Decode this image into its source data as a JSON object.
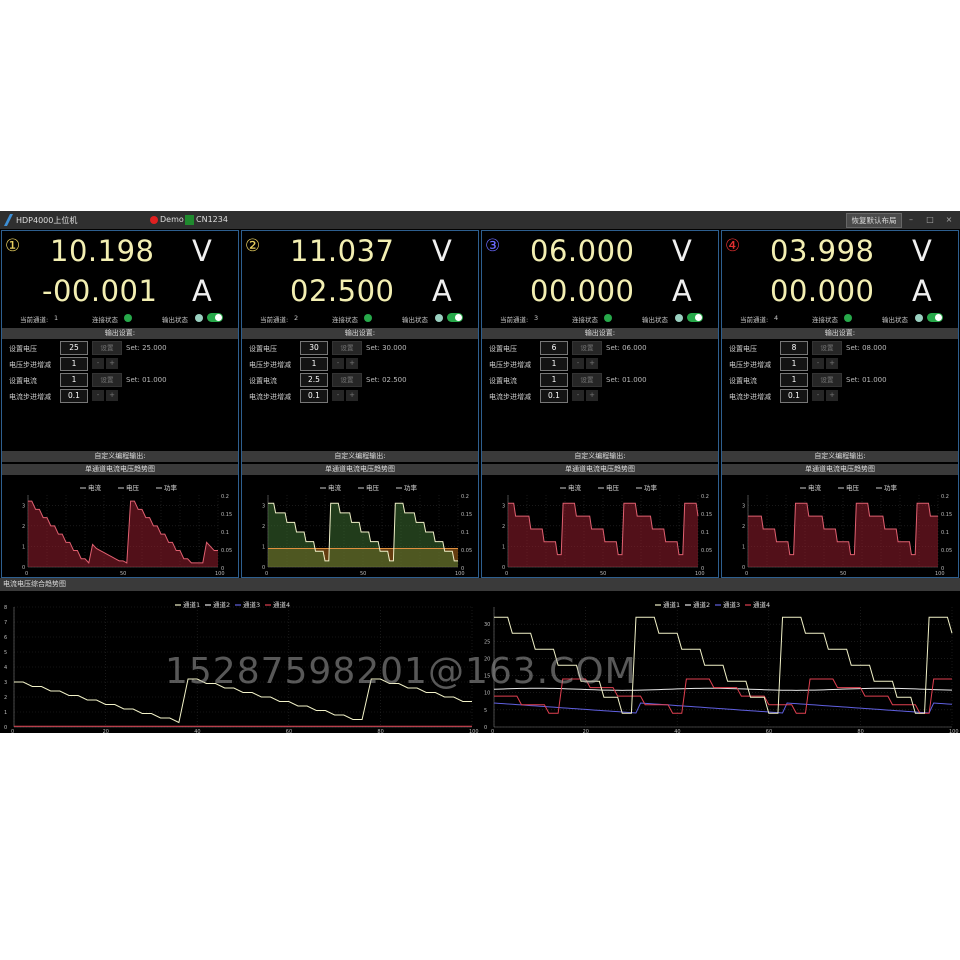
{
  "titlebar": {
    "title": "HDP4000上位机",
    "demo_label": "Demo",
    "cn_label": "CN1234",
    "restore_label": "恢复默认布局",
    "min_symbol": "–",
    "max_symbol": "□",
    "close_symbol": "×"
  },
  "labels": {
    "current_channel": "当前通道:",
    "connection_status": "连接状态",
    "output_status": "输出状态",
    "output_settings": "输出设置:",
    "set_voltage": "设置电压",
    "voltage_step": "电压步进增减",
    "set_current": "设置电流",
    "current_step": "电流步进增减",
    "set_button": "设置",
    "minus": "-",
    "plus": "+",
    "custom_program": "自定义编程输出:",
    "single_trend": "单通道电流电压趋势图",
    "unit_v": "V",
    "unit_a": "A",
    "legend_current": "电流",
    "legend_voltage": "电压",
    "legend_power": "功率"
  },
  "channels": [
    {
      "badge": "①",
      "badge_color": "#e8d060",
      "voltage": "10.198",
      "current": "-00.001",
      "num": "1",
      "set_voltage": "25",
      "voltage_step": "1",
      "set_current": "1",
      "current_step": "0.1",
      "set_voltage_display": "Set: 25.000",
      "set_current_display": "Set: 01.000"
    },
    {
      "badge": "②",
      "badge_color": "#e8d060",
      "voltage": "11.037",
      "current": "02.500",
      "num": "2",
      "set_voltage": "30",
      "voltage_step": "1",
      "set_current": "2.5",
      "current_step": "0.1",
      "set_voltage_display": "Set: 30.000",
      "set_current_display": "Set: 02.500"
    },
    {
      "badge": "③",
      "badge_color": "#6b6bff",
      "voltage": "06.000",
      "current": "00.000",
      "num": "3",
      "set_voltage": "6",
      "voltage_step": "1",
      "set_current": "1",
      "current_step": "0.1",
      "set_voltage_display": "Set: 06.000",
      "set_current_display": "Set: 01.000"
    },
    {
      "badge": "④",
      "badge_color": "#e03030",
      "voltage": "03.998",
      "current": "00.000",
      "num": "4",
      "set_voltage": "8",
      "voltage_step": "1",
      "set_current": "1",
      "current_step": "0.1",
      "set_voltage_display": "Set: 08.000",
      "set_current_display": "Set: 01.000"
    }
  ],
  "bottom": {
    "title": "电流电压综合趋势图",
    "legend": [
      "通道1",
      "通道2",
      "通道3",
      "通道4"
    ],
    "series_colors": [
      "#f2f2c8",
      "#e8e8e8",
      "#6060e0",
      "#e04050"
    ]
  },
  "watermark": "15287598201@163.COM",
  "chart_data": [
    {
      "type": "line",
      "chart": "channel-1",
      "x": [
        0,
        2,
        4,
        6,
        8,
        10,
        12,
        14,
        16,
        18,
        20,
        22,
        24,
        26,
        28,
        30,
        32,
        34,
        36,
        38,
        40,
        42,
        44,
        46,
        48,
        50,
        52,
        54,
        56,
        58,
        60,
        62,
        64,
        66,
        68,
        70,
        72,
        74,
        76,
        78,
        80,
        82,
        84,
        86,
        88,
        90,
        92,
        94,
        96,
        98,
        100
      ],
      "series": [
        {
          "name": "电流",
          "values": [
            3.2,
            3.2,
            2.8,
            2.8,
            2.4,
            2.4,
            2.0,
            2.0,
            1.6,
            1.6,
            1.2,
            1.2,
            0.8,
            0.8,
            0.4,
            0.4,
            0.2,
            1.1,
            0.9,
            0.8,
            0.7,
            0.6,
            0.5,
            0.4,
            0.3,
            0.3,
            0.2,
            3.2,
            3.2,
            2.8,
            2.8,
            2.4,
            2.4,
            2.0,
            2.0,
            1.6,
            1.6,
            1.2,
            1.2,
            0.8,
            0.8,
            0.4,
            0.4,
            0.2,
            0.2,
            0.2,
            0.2,
            1.2,
            1.0,
            0.8,
            0.8
          ]
        }
      ],
      "xlim": [
        0,
        100
      ],
      "ylim": [
        0,
        3.5
      ]
    },
    {
      "type": "line",
      "chart": "channel-2",
      "x": [
        0,
        100
      ],
      "xlim": [
        0,
        100
      ],
      "ylim": [
        0,
        3.5
      ]
    },
    {
      "type": "line",
      "chart": "channel-3",
      "x": [
        0,
        100
      ],
      "xlim": [
        0,
        100
      ],
      "ylim": [
        0,
        3.5
      ]
    },
    {
      "type": "line",
      "chart": "channel-4",
      "x": [
        0,
        100
      ],
      "xlim": [
        0,
        100
      ],
      "ylim": [
        0,
        3.5
      ]
    },
    {
      "type": "line",
      "chart": "combined-left",
      "x": [
        0,
        2,
        4,
        6,
        8,
        10,
        12,
        14,
        16,
        18,
        20,
        22,
        24,
        26,
        28,
        30,
        32,
        34,
        36,
        38,
        40,
        42,
        44,
        46,
        48,
        50,
        52,
        54,
        56,
        58,
        60,
        62,
        64,
        66,
        68,
        70,
        72,
        74,
        76,
        78,
        80,
        82,
        84,
        86,
        88,
        90,
        92,
        94,
        96,
        98,
        100
      ],
      "series": [
        {
          "name": "通道1",
          "values": [
            3.0,
            3.0,
            2.7,
            2.7,
            2.4,
            2.4,
            2.1,
            2.1,
            1.8,
            1.8,
            1.5,
            1.5,
            1.2,
            1.2,
            0.9,
            0.9,
            0.6,
            0.6,
            0.3,
            3.2,
            3.2,
            2.9,
            2.9,
            2.6,
            2.6,
            2.3,
            2.3,
            2.0,
            2.0,
            1.7,
            1.7,
            1.4,
            1.4,
            1.1,
            1.1,
            0.8,
            0.8,
            0.5,
            0.5,
            3.2,
            3.2,
            2.9,
            2.9,
            2.6,
            2.6,
            2.3,
            2.3,
            2.0,
            2.0,
            1.7,
            1.7
          ]
        }
      ],
      "xlim": [
        0,
        100
      ],
      "ylim": [
        0,
        8
      ],
      "yticks": [
        0,
        1,
        2,
        3,
        4,
        5,
        6,
        7,
        8
      ],
      "xticks": [
        0,
        20,
        40,
        60,
        80,
        100
      ]
    },
    {
      "type": "line",
      "chart": "combined-right",
      "x": [
        0,
        100
      ],
      "xlim": [
        0,
        100
      ],
      "ylim": [
        0,
        35
      ],
      "yticks": [
        0,
        5,
        10,
        15,
        20,
        25,
        30
      ],
      "xticks": [
        0,
        20,
        40,
        60,
        80,
        100
      ]
    }
  ]
}
